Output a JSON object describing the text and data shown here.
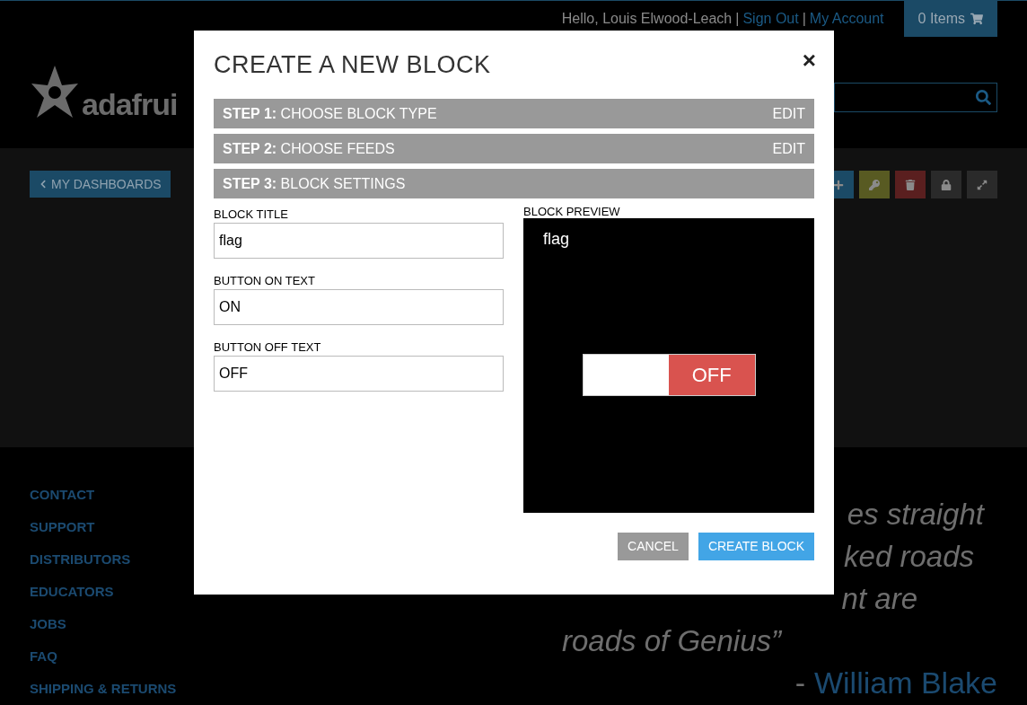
{
  "top_bar": {
    "greeting": "Hello, Louis Elwood-Leach",
    "separator_1": "|",
    "sign_out": "Sign Out",
    "separator_2": "|",
    "my_account": "My Account",
    "cart": "0 Items"
  },
  "logo": {
    "text": "adafrui"
  },
  "back_button": "MY DASHBOARDS",
  "toolbar": [
    {
      "kind": "add",
      "color": "#1b4a66"
    },
    {
      "kind": "key",
      "color": "#585a22"
    },
    {
      "kind": "delete",
      "color": "#5a1f1f"
    },
    {
      "kind": "lock",
      "color": "#2a2a2a"
    },
    {
      "kind": "expand",
      "color": "#2a2a2a"
    }
  ],
  "footer_links": [
    "CONTACT",
    "SUPPORT",
    "DISTRIBUTORS",
    "EDUCATORS",
    "JOBS",
    "FAQ",
    "SHIPPING & RETURNS"
  ],
  "quote": {
    "lines": [
      "es straight",
      "ked roads",
      "nt are",
      "roads of Genius”"
    ],
    "dash": "-",
    "author": "William Blake"
  },
  "modal": {
    "title": "CREATE A NEW BLOCK",
    "close": "×",
    "steps": [
      {
        "label": "**STEP 1:** CHOOSE BLOCK TYPE",
        "action": "EDIT"
      },
      {
        "label": "**STEP 2:** CHOOSE FEEDS",
        "action": "EDIT"
      },
      {
        "label": "**STEP 3:** BLOCK SETTINGS"
      }
    ],
    "fields": [
      {
        "label": "BLOCK TITLE",
        "value": "flag"
      },
      {
        "label": "BUTTON ON TEXT",
        "value": "ON"
      },
      {
        "label": "BUTTON OFF TEXT",
        "value": "OFF"
      }
    ],
    "preview": {
      "label": "BLOCK PREVIEW",
      "title": "flag",
      "toggle": {
        "on": false,
        "text": "OFF"
      }
    },
    "buttons": [
      {
        "kind": "cancel",
        "label": "CANCEL"
      },
      {
        "kind": "primary",
        "label": "CREATE BLOCK"
      }
    ]
  }
}
